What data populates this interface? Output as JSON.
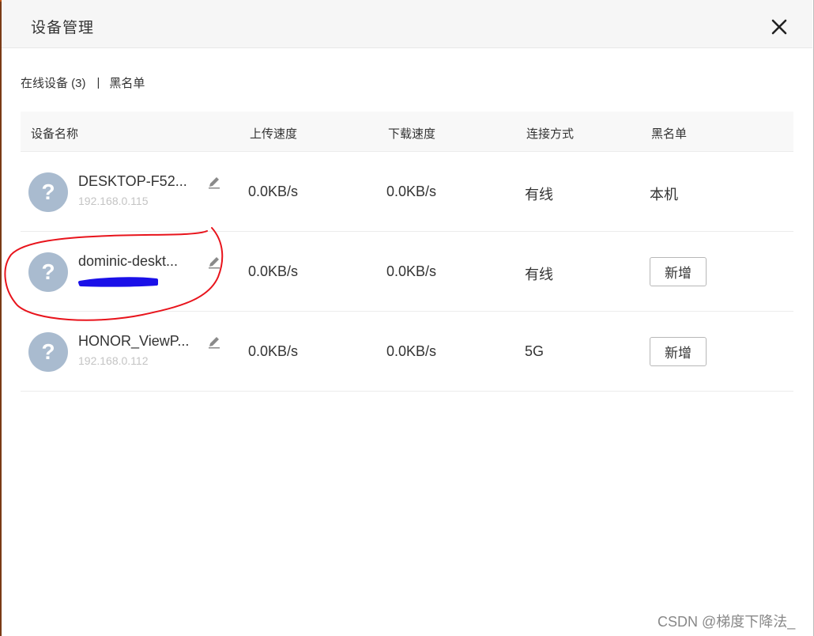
{
  "dialog": {
    "title": "设备管理"
  },
  "tabs": {
    "online": "在线设备 (3)",
    "separator": "|",
    "blacklist": "黑名单"
  },
  "columns": [
    "设备名称",
    "上传速度",
    "下载速度",
    "连接方式",
    "黑名单"
  ],
  "devices": [
    {
      "name": "DESKTOP-F52...",
      "ip": "192.168.0.115",
      "upload": "0.0KB/s",
      "download": "0.0KB/s",
      "connection": "有线",
      "blacklist_text": "本机"
    },
    {
      "name": "dominic-deskt...",
      "ip": "",
      "upload": "0.0KB/s",
      "download": "0.0KB/s",
      "connection": "有线",
      "blacklist_button": "新增"
    },
    {
      "name": "HONOR_ViewP...",
      "ip": "192.168.0.112",
      "upload": "0.0KB/s",
      "download": "0.0KB/s",
      "connection": "5G",
      "blacklist_button": "新增"
    }
  ],
  "icons": {
    "close": "close-icon",
    "edit": "pencil-icon",
    "avatar": "question-mark-icon"
  },
  "colors": {
    "avatar": "#a9bbcf",
    "annotation_circle": "#e8141c",
    "redaction": "#1a10e8"
  },
  "watermark": "CSDN @梯度下降法_"
}
